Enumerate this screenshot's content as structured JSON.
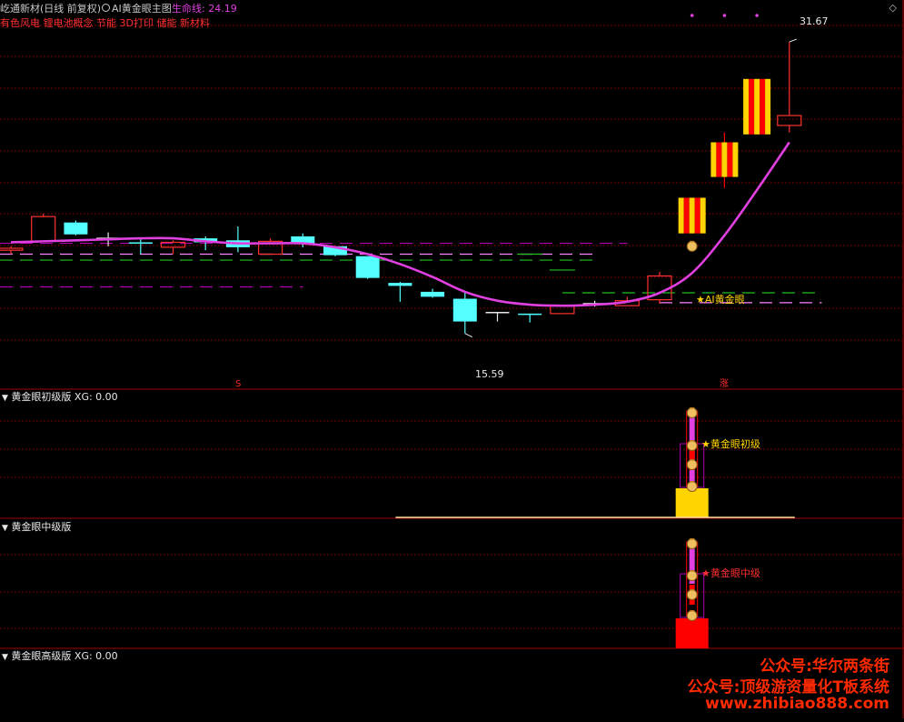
{
  "header": {
    "stock_title": "屹通新材(日线 前复权)",
    "indicator_name": "AI黄金眼主图",
    "life_line_label": "生命线:",
    "life_line_value": "24.19",
    "concepts": "有色风电 锂电池概念 节能 3D打印 储能 新材料"
  },
  "panels": [
    {
      "title": "黄金眼初级版",
      "xg": "XG: 0.00",
      "signal_label": "★黄金眼初级"
    },
    {
      "title": "黄金眼中级版",
      "signal_label": "★黄金眼中级"
    },
    {
      "title": "黄金眼高级版",
      "xg": "XG: 0.00"
    }
  ],
  "markers": {
    "high_label": "31.67",
    "low_label": "15.59",
    "signal_label": "★AI黄金眼",
    "s_mark": "S",
    "zhang_mark": "涨"
  },
  "watermark": {
    "line1": "公众号:华尔两条街",
    "line2": "公众号:顶级游资量化T板系统",
    "line3": "www.zhibiao888.com"
  },
  "colors": {
    "up": "#ff3030",
    "down": "#54ffff",
    "life_line": "#e040e0",
    "gold": "#ffd400",
    "red": "#ff0000",
    "grid": "#7a0000"
  },
  "chart_data": {
    "type": "candlestick",
    "ylim": [
      14.5,
      32.5
    ],
    "candles": [
      {
        "o": 21.25,
        "h": 21.35,
        "l": 20.95,
        "c": 21.15,
        "kind": "up"
      },
      {
        "o": 21.6,
        "h": 23.0,
        "l": 21.6,
        "c": 22.85,
        "kind": "up"
      },
      {
        "o": 22.55,
        "h": 22.65,
        "l": 21.9,
        "c": 21.95,
        "kind": "down"
      },
      {
        "o": 21.75,
        "h": 22.05,
        "l": 21.35,
        "c": 21.75,
        "kind": "doji"
      },
      {
        "o": 21.55,
        "h": 21.75,
        "l": 20.95,
        "c": 21.5,
        "kind": "down"
      },
      {
        "o": 21.3,
        "h": 21.65,
        "l": 20.95,
        "c": 21.55,
        "kind": "up"
      },
      {
        "o": 21.75,
        "h": 21.85,
        "l": 21.15,
        "c": 21.55,
        "kind": "down"
      },
      {
        "o": 21.65,
        "h": 22.35,
        "l": 21.05,
        "c": 21.3,
        "kind": "down"
      },
      {
        "o": 20.95,
        "h": 21.75,
        "l": 20.95,
        "c": 21.6,
        "kind": "up"
      },
      {
        "o": 21.85,
        "h": 22.0,
        "l": 21.3,
        "c": 21.5,
        "kind": "down"
      },
      {
        "o": 21.35,
        "h": 21.35,
        "l": 20.85,
        "c": 20.9,
        "kind": "down"
      },
      {
        "o": 20.85,
        "h": 20.85,
        "l": 19.7,
        "c": 19.75,
        "kind": "down"
      },
      {
        "o": 19.5,
        "h": 19.55,
        "l": 18.55,
        "c": 19.35,
        "kind": "down"
      },
      {
        "o": 19.05,
        "h": 19.2,
        "l": 18.75,
        "c": 18.8,
        "kind": "down"
      },
      {
        "o": 18.7,
        "h": 19.05,
        "l": 16.95,
        "c": 17.55,
        "kind": "down"
      },
      {
        "o": 18.0,
        "h": 18.0,
        "l": 17.55,
        "c": 17.95,
        "kind": "doji"
      },
      {
        "o": 17.95,
        "h": 17.95,
        "l": 17.5,
        "c": 17.9,
        "kind": "down"
      },
      {
        "o": 17.95,
        "h": 18.35,
        "l": 17.95,
        "c": 18.35,
        "kind": "up"
      },
      {
        "o": 18.45,
        "h": 18.6,
        "l": 18.3,
        "c": 18.45,
        "kind": "doji"
      },
      {
        "o": 18.35,
        "h": 18.8,
        "l": 18.35,
        "c": 18.6,
        "kind": "up"
      },
      {
        "o": 18.65,
        "h": 20.05,
        "l": 18.45,
        "c": 19.85,
        "kind": "up"
      },
      {
        "o": 22.0,
        "h": 23.8,
        "l": 22.0,
        "c": 23.8,
        "kind": "gold"
      },
      {
        "o": 24.85,
        "h": 27.1,
        "l": 24.3,
        "c": 26.6,
        "kind": "gold"
      },
      {
        "o": 27.0,
        "h": 29.8,
        "l": 27.0,
        "c": 29.8,
        "kind": "gold"
      },
      {
        "o": 27.45,
        "h": 31.67,
        "l": 27.1,
        "c": 27.95,
        "kind": "up"
      }
    ],
    "life_line": [
      21.55,
      21.6,
      21.65,
      21.7,
      21.75,
      21.75,
      21.6,
      21.5,
      21.5,
      21.5,
      21.3,
      20.95,
      20.45,
      19.8,
      19.05,
      18.6,
      18.4,
      18.35,
      18.4,
      18.55,
      19.0,
      20.0,
      21.9,
      24.19,
      26.6
    ],
    "dash_levels": [
      {
        "y": 21.5,
        "color": "#b000b0",
        "span": [
          -1,
          19
        ]
      },
      {
        "y": 20.95,
        "color": "#ff80ff",
        "span": [
          -1,
          18
        ]
      },
      {
        "y": 20.65,
        "color": "#20c020",
        "span": [
          -1,
          18
        ]
      },
      {
        "y": 19.3,
        "color": "#b000b0",
        "span": [
          -1,
          9
        ]
      },
      {
        "y": 19.0,
        "color": "#20c020",
        "span": [
          17,
          25
        ]
      },
      {
        "y": 18.5,
        "color": "#ff80ff",
        "span": [
          20,
          25
        ]
      }
    ],
    "green_ticks": [
      {
        "i": 16,
        "y": 20.95
      },
      {
        "i": 17,
        "y": 20.15
      }
    ]
  }
}
